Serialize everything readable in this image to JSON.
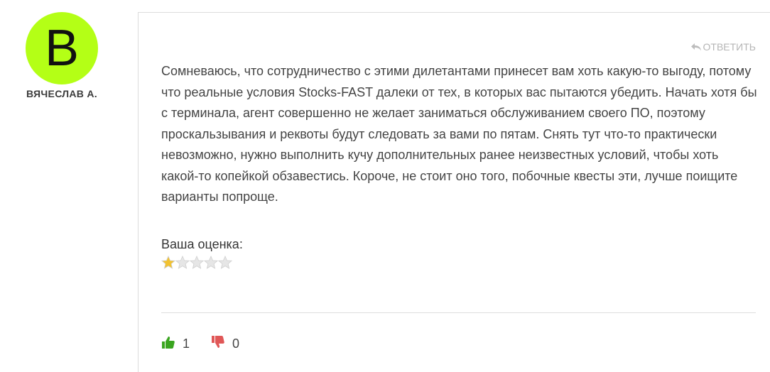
{
  "author": {
    "avatar_letter": "B",
    "avatar_color": "#b4ff16",
    "name": "ВЯЧЕСЛАВ А."
  },
  "comment": {
    "reply_label": "ОТВЕТИТЬ",
    "reply_icon": "reply-arrow-icon",
    "text": "Сомневаюсь, что сотрудничество с этими дилетантами принесет вам хоть какую-то выгоду, потому что реальные условия Stocks-FAST далеки от тех, в которых вас пытаются убедить. Начать хотя бы с терминала, агент совершенно не желает заниматься обслуживанием своего ПО, поэтому проскальзывания и реквоты будут следовать за вами по пятам. Снять тут что-то практически невозможно, нужно выполнить кучу дополнительных ранее неизвестных условий, чтобы хоть какой-то копейкой обзавестись. Короче, не стоит оно того, побочные квесты эти, лучше поищите варианты попроще."
  },
  "rating": {
    "label": "Ваша оценка:",
    "value": 1,
    "max": 5,
    "filled_color": "#f2c230",
    "empty_color": "#e6e6e6"
  },
  "votes": {
    "likes": "1",
    "dislikes": "0",
    "like_color": "#3aa51f",
    "dislike_color": "#e05757"
  }
}
